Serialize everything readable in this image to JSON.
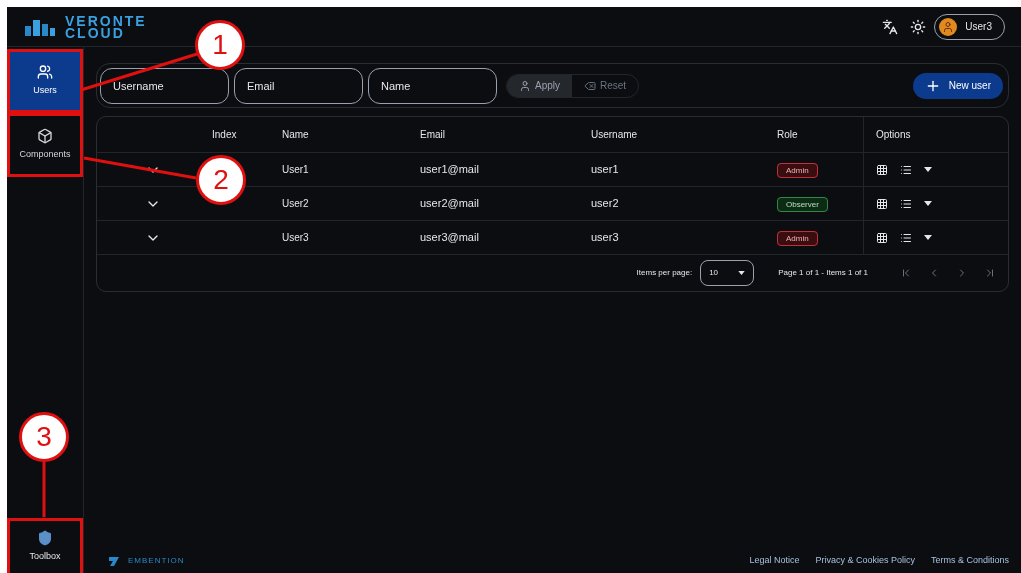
{
  "header": {
    "logo_top": "VERONTE",
    "logo_bottom": "CLOUD",
    "user": "User3"
  },
  "sidebar": {
    "items": [
      {
        "label": "Users",
        "kind": "users",
        "selected": true,
        "callout": "1"
      },
      {
        "label": "Components",
        "kind": "cube",
        "selected": false,
        "callout": "2"
      }
    ],
    "bottom_item": {
      "label": "Toolbox",
      "kind": "toolbox",
      "callout": "3"
    }
  },
  "filters": {
    "fields": [
      {
        "placeholder": "Username"
      },
      {
        "placeholder": "Email"
      },
      {
        "placeholder": "Name"
      }
    ],
    "apply": "Apply",
    "reset": "Reset",
    "new_user": "New user"
  },
  "table": {
    "columns": [
      "Index",
      "Name",
      "Email",
      "Username",
      "Role",
      "Options"
    ],
    "rows": [
      {
        "name": "User1",
        "email": "user1@mail",
        "username": "user1",
        "role": "Admin",
        "kind": "admin"
      },
      {
        "name": "User2",
        "email": "user2@mail",
        "username": "user2",
        "role": "Observer",
        "kind": "observer"
      },
      {
        "name": "User3",
        "email": "user3@mail",
        "username": "user3",
        "role": "Admin",
        "kind": "admin"
      }
    ],
    "paginator": {
      "label": "Items per page:",
      "per_page": "10",
      "range": "Page 1 of 1 - Items 1 of 1"
    }
  },
  "footer": {
    "brand": "EMBENTION",
    "links": [
      "Legal Notice",
      "Privacy & Cookies Policy",
      "Terms & Conditions"
    ]
  }
}
